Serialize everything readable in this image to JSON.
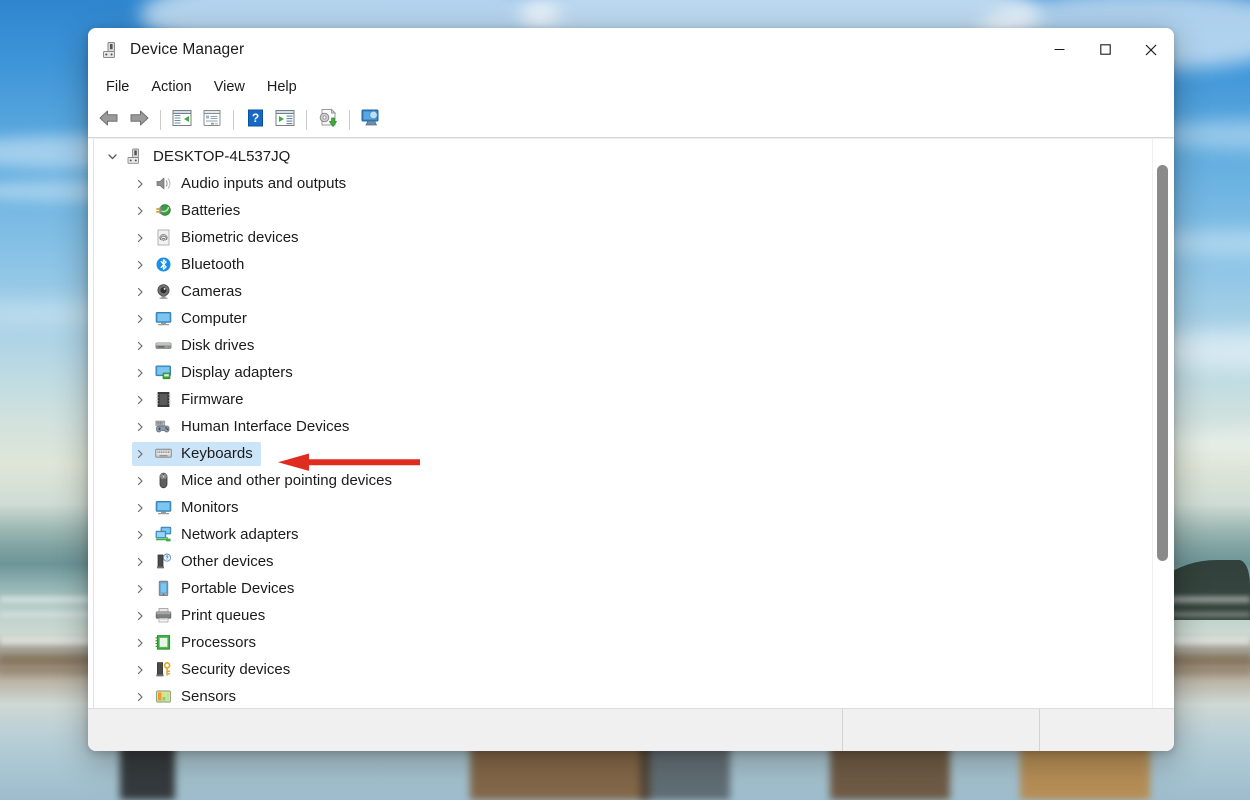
{
  "window": {
    "title": "Device Manager",
    "app_icon": "device-manager-icon",
    "controls": {
      "minimize": "minimize-icon",
      "maximize": "maximize-icon",
      "close": "close-icon"
    }
  },
  "menubar": {
    "items": [
      {
        "label": "File"
      },
      {
        "label": "Action"
      },
      {
        "label": "View"
      },
      {
        "label": "Help"
      }
    ]
  },
  "toolbar": {
    "buttons": [
      {
        "name": "back-button",
        "icon": "back-arrow-icon",
        "tooltip": "Back"
      },
      {
        "name": "forward-button",
        "icon": "forward-arrow-icon",
        "tooltip": "Forward"
      },
      {
        "name": "show-hide-console-tree-button",
        "icon": "console-tree-icon",
        "tooltip": "Show/Hide Console Tree"
      },
      {
        "name": "properties-button",
        "icon": "properties-icon",
        "tooltip": "Properties"
      },
      {
        "name": "help-button",
        "icon": "help-question-icon",
        "tooltip": "Help"
      },
      {
        "name": "scan-hardware-changes-button",
        "icon": "scan-hardware-icon",
        "tooltip": "Scan for hardware changes"
      },
      {
        "name": "update-driver-button",
        "icon": "update-driver-icon",
        "tooltip": "Update driver"
      },
      {
        "name": "add-legacy-hardware-button",
        "icon": "add-legacy-hardware-icon",
        "tooltip": "Add legacy hardware"
      }
    ]
  },
  "tree": {
    "root": {
      "label": "DESKTOP-4L537JQ",
      "icon": "computer-node-icon",
      "expanded": true,
      "chevron": "chevron-down"
    },
    "children": [
      {
        "label": "Audio inputs and outputs",
        "icon": "speaker-icon",
        "selected": false
      },
      {
        "label": "Batteries",
        "icon": "battery-icon",
        "selected": false
      },
      {
        "label": "Biometric devices",
        "icon": "fingerprint-icon",
        "selected": false
      },
      {
        "label": "Bluetooth",
        "icon": "bluetooth-icon",
        "selected": false
      },
      {
        "label": "Cameras",
        "icon": "camera-icon",
        "selected": false
      },
      {
        "label": "Computer",
        "icon": "monitor-icon",
        "selected": false
      },
      {
        "label": "Disk drives",
        "icon": "disk-drive-icon",
        "selected": false
      },
      {
        "label": "Display adapters",
        "icon": "display-adapter-icon",
        "selected": false
      },
      {
        "label": "Firmware",
        "icon": "firmware-chip-icon",
        "selected": false
      },
      {
        "label": "Human Interface Devices",
        "icon": "hid-gamepad-icon",
        "selected": false
      },
      {
        "label": "Keyboards",
        "icon": "keyboard-icon",
        "selected": true
      },
      {
        "label": "Mice and other pointing devices",
        "icon": "mouse-icon",
        "selected": false
      },
      {
        "label": "Monitors",
        "icon": "monitor-icon",
        "selected": false
      },
      {
        "label": "Network adapters",
        "icon": "network-adapter-icon",
        "selected": false
      },
      {
        "label": "Other devices",
        "icon": "unknown-device-icon",
        "selected": false
      },
      {
        "label": "Portable Devices",
        "icon": "portable-device-icon",
        "selected": false
      },
      {
        "label": "Print queues",
        "icon": "printer-icon",
        "selected": false
      },
      {
        "label": "Processors",
        "icon": "processor-icon",
        "selected": false
      },
      {
        "label": "Security devices",
        "icon": "security-key-icon",
        "selected": false
      },
      {
        "label": "Sensors",
        "icon": "sensor-icon",
        "selected": false
      }
    ],
    "child_chevron": "chevron-right"
  },
  "scrollbar": {
    "name": "vertical-scrollbar",
    "thumb_color": "#8a8a8a"
  },
  "statusbar": {
    "panes": [
      "",
      "",
      ""
    ]
  },
  "annotation": {
    "arrow": {
      "name": "red-annotation-arrow",
      "color": "#e02b20",
      "direction": "left",
      "points_at": "Keyboards"
    }
  },
  "colors": {
    "selection_highlight": "#cce4f7",
    "window_background": "#ffffff",
    "statusbar_background": "#f0f0f0",
    "annotation_red": "#e02b20"
  }
}
